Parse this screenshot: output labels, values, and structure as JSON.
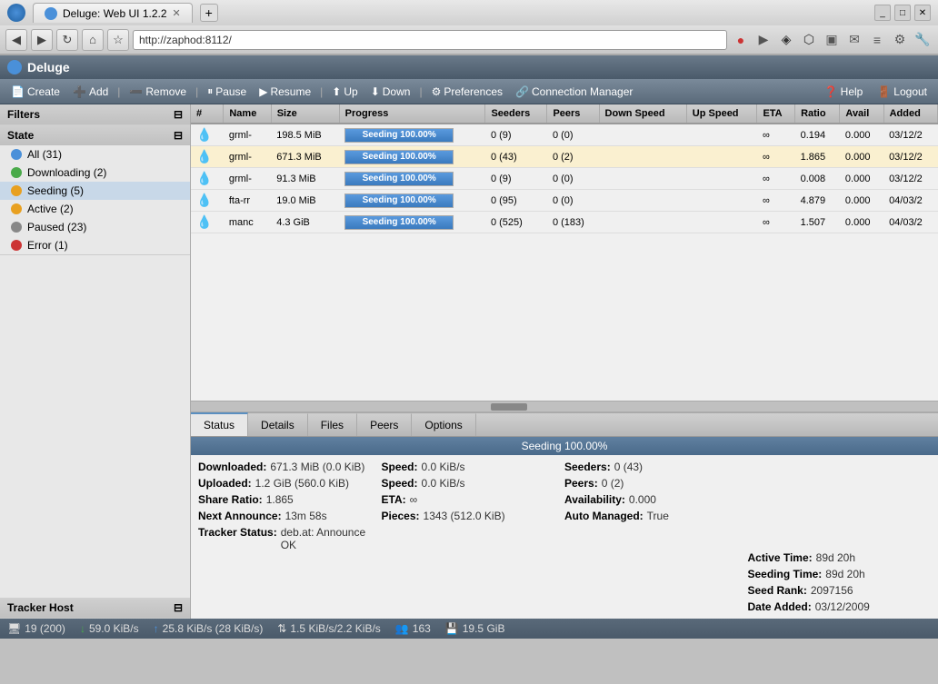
{
  "browser": {
    "title": "Deluge: Web UI 1.2.2 - Chromium",
    "tab_label": "Deluge: Web UI 1.2.2",
    "url": "http://zaphod:8112/"
  },
  "app": {
    "title": "Deluge"
  },
  "toolbar": {
    "create": "Create",
    "add": "Add",
    "remove": "Remove",
    "pause": "Pause",
    "resume": "Resume",
    "up": "Up",
    "down": "Down",
    "preferences": "Preferences",
    "connection_manager": "Connection Manager",
    "help": "Help",
    "logout": "Logout"
  },
  "sidebar": {
    "filters_label": "Filters",
    "state_label": "State",
    "states": [
      {
        "label": "All (31)",
        "icon": "blue",
        "active": false
      },
      {
        "label": "Downloading (2)",
        "icon": "green",
        "active": false
      },
      {
        "label": "Seeding (5)",
        "icon": "orange",
        "active": true
      },
      {
        "label": "Active (2)",
        "icon": "orange",
        "active": false
      },
      {
        "label": "Paused (23)",
        "icon": "gray",
        "active": false
      },
      {
        "label": "Error (1)",
        "icon": "red",
        "active": false
      }
    ],
    "tracker_host_label": "Tracker Host"
  },
  "table": {
    "columns": [
      "#",
      "Name",
      "Size",
      "Progress",
      "Seeders",
      "Peers",
      "Down Speed",
      "Up Speed",
      "ETA",
      "Ratio",
      "Avail",
      "Added"
    ],
    "rows": [
      {
        "num": "",
        "name": "grml-",
        "size": "198.5 MiB",
        "progress": 100,
        "progress_label": "Seeding 100.00%",
        "seeders": "0 (9)",
        "peers": "0 (0)",
        "down_speed": "",
        "up_speed": "",
        "eta": "∞",
        "ratio": "0.194",
        "avail": "0.000",
        "added": "03/12/2",
        "selected": false
      },
      {
        "num": "",
        "name": "grml-",
        "size": "671.3 MiB",
        "progress": 100,
        "progress_label": "Seeding 100.00%",
        "seeders": "0 (43)",
        "peers": "0 (2)",
        "down_speed": "",
        "up_speed": "",
        "eta": "∞",
        "ratio": "1.865",
        "avail": "0.000",
        "added": "03/12/2",
        "selected": true
      },
      {
        "num": "",
        "name": "grml-",
        "size": "91.3 MiB",
        "progress": 100,
        "progress_label": "Seeding 100.00%",
        "seeders": "0 (9)",
        "peers": "0 (0)",
        "down_speed": "",
        "up_speed": "",
        "eta": "∞",
        "ratio": "0.008",
        "avail": "0.000",
        "added": "03/12/2",
        "selected": false
      },
      {
        "num": "",
        "name": "fta-rr",
        "size": "19.0 MiB",
        "progress": 100,
        "progress_label": "Seeding 100.00%",
        "seeders": "0 (95)",
        "peers": "0 (0)",
        "down_speed": "",
        "up_speed": "",
        "eta": "∞",
        "ratio": "4.879",
        "avail": "0.000",
        "added": "04/03/2",
        "selected": false
      },
      {
        "num": "",
        "name": "manc",
        "size": "4.3 GiB",
        "progress": 100,
        "progress_label": "Seeding 100.00%",
        "seeders": "0 (525)",
        "peers": "0 (183)",
        "down_speed": "",
        "up_speed": "",
        "eta": "∞",
        "ratio": "1.507",
        "avail": "0.000",
        "added": "04/03/2",
        "selected": false
      }
    ]
  },
  "detail_tabs": [
    "Status",
    "Details",
    "Files",
    "Peers",
    "Options"
  ],
  "detail": {
    "title": "Seeding 100.00%",
    "downloaded_label": "Downloaded:",
    "downloaded_value": "671.3 MiB (0.0 KiB)",
    "uploaded_label": "Uploaded:",
    "uploaded_value": "1.2 GiB (560.0 KiB)",
    "share_ratio_label": "Share Ratio:",
    "share_ratio_value": "1.865",
    "next_announce_label": "Next Announce:",
    "next_announce_value": "13m 58s",
    "tracker_status_label": "Tracker Status:",
    "tracker_status_value": "deb.at: Announce OK",
    "speed_label1": "Speed:",
    "speed_value1": "0.0 KiB/s",
    "speed_label2": "Speed:",
    "speed_value2": "0.0 KiB/s",
    "eta_label": "ETA:",
    "eta_value": "∞",
    "pieces_label": "Pieces:",
    "pieces_value": "1343 (512.0 KiB)",
    "seeders_label": "Seeders:",
    "seeders_value": "0 (43)",
    "peers_label": "Peers:",
    "peers_value": "0 (2)",
    "availability_label": "Availability:",
    "availability_value": "0.000",
    "auto_managed_label": "Auto Managed:",
    "auto_managed_value": "True",
    "active_time_label": "Active Time:",
    "active_time_value": "89d 20h",
    "seeding_time_label": "Seeding Time:",
    "seeding_time_value": "89d 20h",
    "seed_rank_label": "Seed Rank:",
    "seed_rank_value": "2097156",
    "date_added_label": "Date Added:",
    "date_added_value": "03/12/2009"
  },
  "statusbar": {
    "connections": "19 (200)",
    "down_speed": "59.0 KiB/s",
    "up_speed": "25.8 KiB/s (28 KiB/s)",
    "dht": "1.5 KiB/s/2.2 KiB/s",
    "peers": "163",
    "disk": "19.5 GiB"
  }
}
